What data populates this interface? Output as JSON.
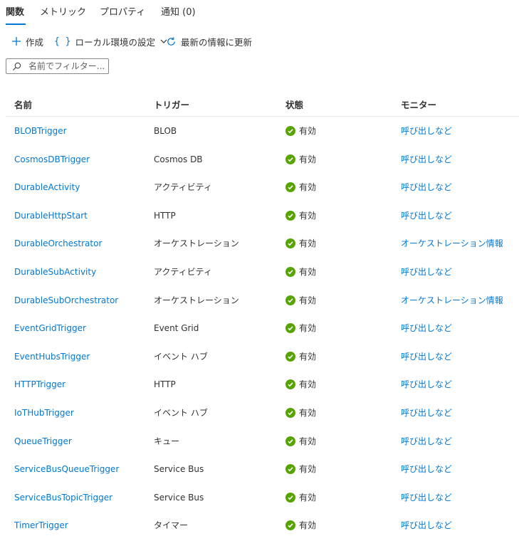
{
  "tabs": [
    {
      "label": "関数",
      "active": true
    },
    {
      "label": "メトリック",
      "active": false
    },
    {
      "label": "プロパティ",
      "active": false
    },
    {
      "label": "通知 (0)",
      "active": false
    }
  ],
  "toolbar": {
    "create_label": "作成",
    "local_settings_label": "ローカル環境の設定",
    "refresh_label": "最新の情報に更新"
  },
  "filter": {
    "placeholder": "名前でフィルター...",
    "value": ""
  },
  "colors": {
    "accent": "#0078d4",
    "status_ok": "#57a300",
    "text": "#323130"
  },
  "table": {
    "headers": {
      "name": "名前",
      "trigger": "トリガー",
      "status": "状態",
      "monitor": "モニター"
    },
    "rows": [
      {
        "name": "BLOBTrigger",
        "trigger": "BLOB",
        "status": "有効",
        "monitor": "呼び出しなど"
      },
      {
        "name": "CosmosDBTrigger",
        "trigger": "Cosmos DB",
        "status": "有効",
        "monitor": "呼び出しなど"
      },
      {
        "name": "DurableActivity",
        "trigger": "アクティビティ",
        "status": "有効",
        "monitor": "呼び出しなど"
      },
      {
        "name": "DurableHttpStart",
        "trigger": "HTTP",
        "status": "有効",
        "monitor": "呼び出しなど"
      },
      {
        "name": "DurableOrchestrator",
        "trigger": "オーケストレーション",
        "status": "有効",
        "monitor": "オーケストレーション情報"
      },
      {
        "name": "DurableSubActivity",
        "trigger": "アクティビティ",
        "status": "有効",
        "monitor": "呼び出しなど"
      },
      {
        "name": "DurableSubOrchestrator",
        "trigger": "オーケストレーション",
        "status": "有効",
        "monitor": "オーケストレーション情報"
      },
      {
        "name": "EventGridTrigger",
        "trigger": "Event Grid",
        "status": "有効",
        "monitor": "呼び出しなど"
      },
      {
        "name": "EventHubsTrigger",
        "trigger": "イベント ハブ",
        "status": "有効",
        "monitor": "呼び出しなど"
      },
      {
        "name": "HTTPTrigger",
        "trigger": "HTTP",
        "status": "有効",
        "monitor": "呼び出しなど"
      },
      {
        "name": "IoTHubTrigger",
        "trigger": "イベント ハブ",
        "status": "有効",
        "monitor": "呼び出しなど"
      },
      {
        "name": "QueueTrigger",
        "trigger": "キュー",
        "status": "有効",
        "monitor": "呼び出しなど"
      },
      {
        "name": "ServiceBusQueueTrigger",
        "trigger": "Service Bus",
        "status": "有効",
        "monitor": "呼び出しなど"
      },
      {
        "name": "ServiceBusTopicTrigger",
        "trigger": "Service Bus",
        "status": "有効",
        "monitor": "呼び出しなど"
      },
      {
        "name": "TimerTrigger",
        "trigger": "タイマー",
        "status": "有効",
        "monitor": "呼び出しなど"
      }
    ]
  }
}
